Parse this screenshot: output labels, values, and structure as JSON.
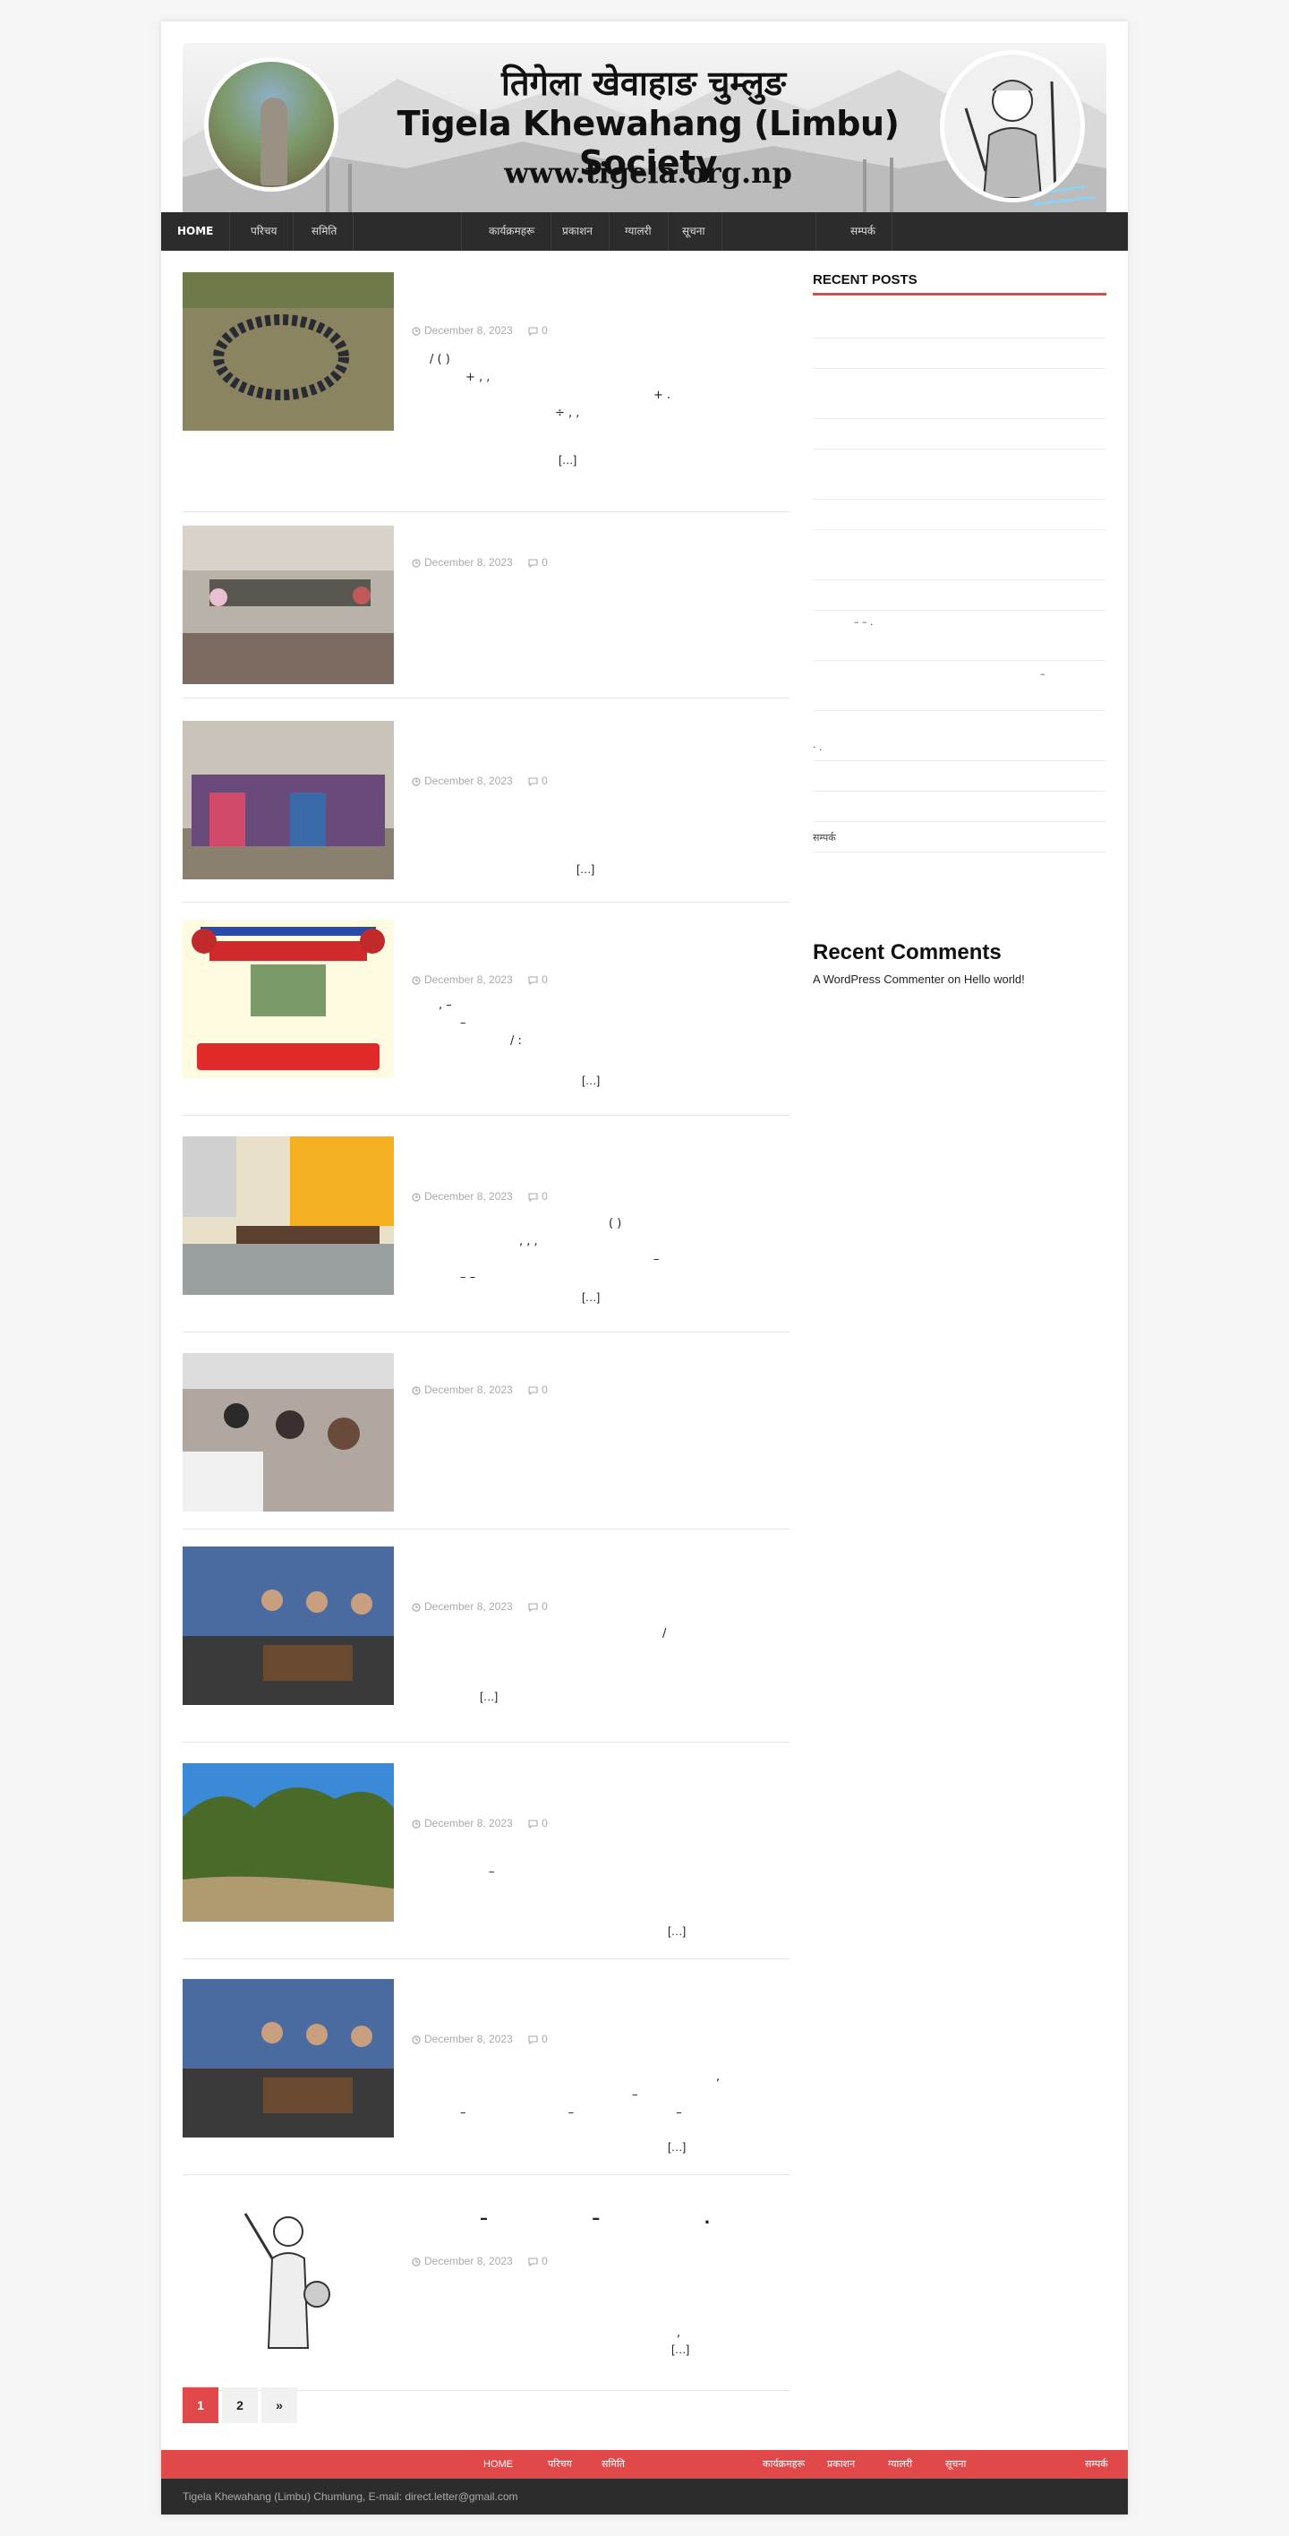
{
  "header": {
    "title_nepali": "तिगेला खेवाहाङ चुम्लुङ",
    "title_english": "Tigela Khewahang (Limbu) Society",
    "url": "www.tigela.org.np"
  },
  "nav": {
    "items": [
      "HOME",
      "परिचय",
      "समिति",
      "",
      "कार्यक्रमहरू",
      "प्रकाशन",
      "ग्यालरी",
      "सूचना",
      "",
      "सम्पर्क"
    ]
  },
  "posts": [
    {
      "date": "December 8, 2023",
      "comments": "0",
      "excerpt": [
        "/ ( )",
        "+ , ,",
        "+ .",
        "÷ , ,"
      ],
      "readmore": "[…]"
    },
    {
      "date": "December 8, 2023",
      "comments": "0",
      "excerpt": [],
      "readmore": ""
    },
    {
      "date": "December 8, 2023",
      "comments": "0",
      "excerpt": [],
      "readmore": "[…]"
    },
    {
      "date": "December 8, 2023",
      "comments": "0",
      "excerpt": [
        ", –",
        "–",
        "/ :"
      ],
      "readmore": "[…]"
    },
    {
      "date": "December 8, 2023",
      "comments": "0",
      "excerpt": [
        "( )",
        ", , ,",
        "–",
        "– –"
      ],
      "readmore": "[…]"
    },
    {
      "date": "December 8, 2023",
      "comments": "0",
      "excerpt": [],
      "readmore": ""
    },
    {
      "date": "December 8, 2023",
      "comments": "0",
      "excerpt": [
        "/"
      ],
      "readmore": "[…]"
    },
    {
      "date": "December 8, 2023",
      "comments": "0",
      "excerpt": [
        "–"
      ],
      "readmore": "[…]"
    },
    {
      "date": "December 8, 2023",
      "comments": "0",
      "excerpt": [
        ",",
        "–",
        "– – –"
      ],
      "readmore": "[…]"
    },
    {
      "date": "December 8, 2023",
      "comments": "0",
      "title": "– – .",
      "excerpt": [
        ","
      ],
      "readmore": "[…]"
    }
  ],
  "sidebar": {
    "recent_posts_title": "RECENT POSTS",
    "recent_posts": [
      "",
      "",
      "",
      "",
      "",
      "",
      "",
      "",
      "– – .",
      "–",
      "· .",
      "",
      "",
      "सम्पर्क"
    ],
    "recent_comments_title": "Recent Comments",
    "recent_comment": {
      "author": "A WordPress Commenter",
      "on": "on",
      "post": "Hello world!"
    }
  },
  "pagination": {
    "pages": [
      "1",
      "2",
      "»"
    ],
    "current": "1"
  },
  "footer": {
    "nav": [
      "HOME",
      "परिचय",
      "समिति",
      "कार्यक्रमहरू",
      "प्रकाशन",
      "ग्यालरी",
      "सूचना",
      "सम्पर्क"
    ],
    "text": "Tigela Khewahang (Limbu) Chumlung, E-mail: direct.letter@gmail.com"
  },
  "colors": {
    "accent": "#e0484a",
    "nav_bg": "#2c2c2c",
    "meta": "#aaaaaa"
  }
}
